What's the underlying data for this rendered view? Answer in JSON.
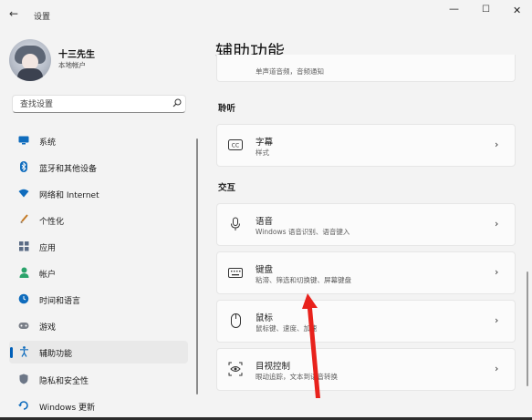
{
  "window": {
    "back_glyph": "←",
    "title": "设置",
    "minimize_glyph": "—",
    "maximize_glyph": "☐",
    "close_glyph": "✕"
  },
  "user": {
    "name": "十三先生",
    "account_type": "本地帐户"
  },
  "search": {
    "placeholder": "查找设置"
  },
  "nav": {
    "items": [
      {
        "label": "系统",
        "icon": "monitor-icon"
      },
      {
        "label": "蓝牙和其他设备",
        "icon": "bluetooth-icon"
      },
      {
        "label": "网络和 Internet",
        "icon": "wifi-icon"
      },
      {
        "label": "个性化",
        "icon": "brush-icon"
      },
      {
        "label": "应用",
        "icon": "apps-icon"
      },
      {
        "label": "帐户",
        "icon": "account-icon"
      },
      {
        "label": "时间和语言",
        "icon": "globe-clock-icon"
      },
      {
        "label": "游戏",
        "icon": "gamepad-icon"
      },
      {
        "label": "辅助功能",
        "icon": "accessibility-icon",
        "selected": true
      },
      {
        "label": "隐私和安全性",
        "icon": "shield-icon"
      },
      {
        "label": "Windows 更新",
        "icon": "windows-update-icon"
      }
    ]
  },
  "main": {
    "title": "辅助功能",
    "partial_card_subtitle": "单声道音频，音频通知",
    "sections": {
      "hearing": "聆听",
      "interaction": "交互"
    },
    "cards": {
      "captions": {
        "title": "字幕",
        "subtitle": "样式",
        "icon": "cc-icon"
      },
      "speech": {
        "title": "语音",
        "subtitle": "Windows 语音识别、语音键入",
        "icon": "microphone-icon"
      },
      "keyboard": {
        "title": "键盘",
        "subtitle": "粘滞、筛选和切换键、屏幕键盘",
        "icon": "keyboard-icon"
      },
      "mouse": {
        "title": "鼠标",
        "subtitle": "鼠标键、速度、加速",
        "icon": "mouse-icon"
      },
      "eye_control": {
        "title": "目视控制",
        "subtitle": "眼动追踪，文本到语音转换",
        "icon": "eye-control-icon"
      }
    },
    "chevron_glyph": "›"
  },
  "colors": {
    "accent": "#005fb8",
    "annotation_arrow": "#e8221c",
    "background": "#f3f3f3",
    "card": "#fbfbfb"
  }
}
